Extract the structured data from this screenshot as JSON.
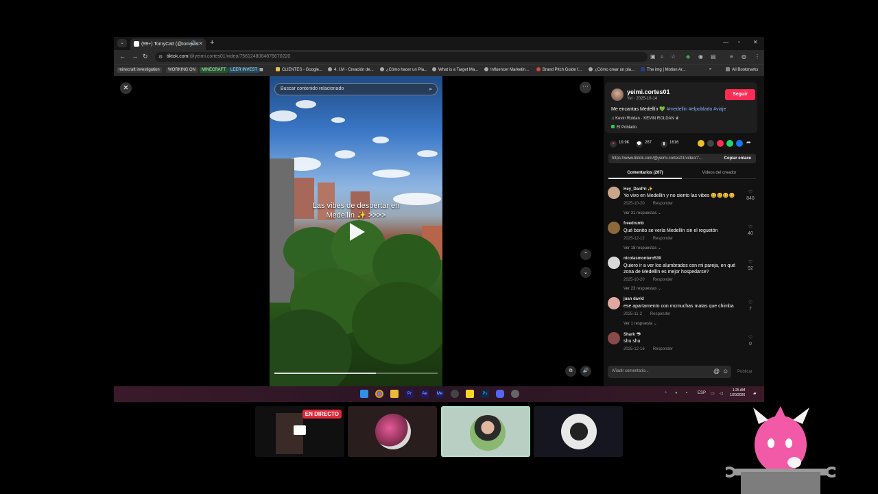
{
  "browser": {
    "tab_title": "(99+) TomyCatt (@tomycat",
    "url_host": "tiktok.com",
    "url_path": "/@yeimi.cortes01/video/7561248084876670220",
    "bookmarks": [
      {
        "label": "minecraft investigation",
        "color": "#3c3c3c"
      },
      {
        "label": "WORKING ON",
        "color": "#3c3c3c"
      },
      {
        "label": "MINECRAFT",
        "color": "#1f5a2a"
      },
      {
        "label": "LEER INVEST",
        "color": "#1e4a63"
      },
      {
        "label": "CLIENTES - Google..."
      },
      {
        "label": "4. I.M - Creación de..."
      },
      {
        "label": "¿Cómo hacer un Pla..."
      },
      {
        "label": "What is a Target Ma..."
      },
      {
        "label": "Influencer Marketin..."
      },
      {
        "label": "Brand Pitch Guide f..."
      },
      {
        "label": "¿Cómo crear un pla..."
      },
      {
        "label": "The img | Motion Ar..."
      }
    ],
    "all_bookmarks": "All Bookmarks"
  },
  "video": {
    "search_placeholder": "Buscar contenido relacionado",
    "caption_line1": "Las vibes de despertar en",
    "caption_line2": "Medellín ✨ >>>>",
    "progress": 0.62
  },
  "post": {
    "username": "yeimi.cortes01",
    "date": "Yei · 2025-10-14",
    "follow_label": "Seguir",
    "description_text": "Me encantas Medellín 💚 ",
    "hashtags": "#medellin #elpoblado #viaje",
    "music": "♫  Kevin Roldan · KEVIN ROLDAN ♛",
    "place": "El Poblado",
    "likes": "19.9K",
    "comments": "267",
    "saves": "1616",
    "link": "https://www.tiktok.com/@yeimi.cortes01/video/7...",
    "copy_link": "Copiar enlace",
    "tab_comments": "Comentarios (267)",
    "tab_creator": "Videos del creador",
    "add_comment_placeholder": "Añadir comentario...",
    "publish": "Publicar"
  },
  "comments": [
    {
      "user": "Hey_DanPri ✨",
      "text": "Yo vivo en Medellín y no siento las vibes 🥴🥴🥴🥴",
      "date": "2025-10-20",
      "reply": "Responder",
      "likes": "848",
      "more": "Ver 31 respuestas ⌄",
      "avatar": "#c9a58a"
    },
    {
      "user": "freedrumb",
      "text": "Qué bonito se vería Medellín sin el reguetón",
      "date": "2025-12-12",
      "reply": "Responder",
      "likes": "40",
      "more": "Ver 18 respuestas ⌄",
      "avatar": "#8a6a3a"
    },
    {
      "user": "nicolasmontero539",
      "text": "Quiero ir a ver los alumbrados con mi pareja, en qué zona de Medellín es mejor hospedarse?",
      "date": "2025-10-20",
      "reply": "Responder",
      "likes": "92",
      "more": "Ver 23 respuestas ⌄",
      "avatar": "#d8d8d8"
    },
    {
      "user": "juan david",
      "text": "ese apartamento con mcmuchas matas que chimba",
      "date": "2025-11-2",
      "reply": "Responder",
      "likes": "7",
      "more": "Ver 1 respuesta ⌄",
      "avatar": "#e0a8a0"
    },
    {
      "user": "Shark 🦈",
      "text": "shu shu",
      "date": "2025-12-16",
      "reply": "Responder",
      "likes": "0",
      "more": "",
      "avatar": "#8a4a4a"
    }
  ],
  "taskbar": {
    "lang": "ESP",
    "time": "1:25 AM",
    "date": "1/20/2026"
  },
  "call": {
    "live_badge": "EN DIRECTO"
  },
  "colors": {
    "accent": "#fe2c55",
    "hashtag": "#7fb4ff"
  }
}
